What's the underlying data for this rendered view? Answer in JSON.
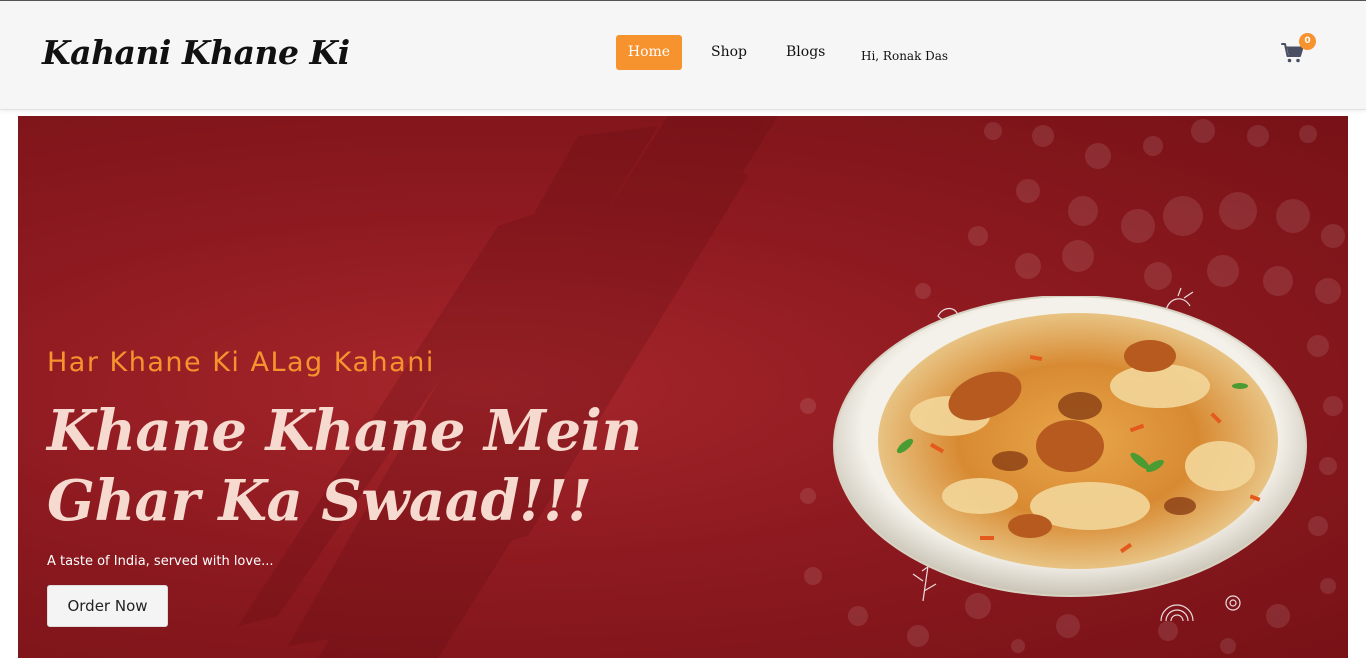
{
  "navbar": {
    "brand": "Kahani Khane Ki",
    "links": [
      {
        "label": "Home",
        "active": true
      },
      {
        "label": "Shop",
        "active": false
      },
      {
        "label": "Blogs",
        "active": false
      }
    ],
    "user_greeting": "Hi, Ronak Das",
    "cart_count": "0"
  },
  "hero": {
    "tagline": "Har Khane Ki ALag Kahani",
    "headline": "Khane Khane Mein Ghar Ka Swaad!!!",
    "subtitle": "A taste of India, served with love...",
    "cta_label": "Order Now"
  },
  "icons": {
    "cart": "cart-icon",
    "hero_image": "biryani-plate-image"
  },
  "colors": {
    "accent": "#f7932e",
    "hero_bg": "#8e1a20",
    "headline": "#f6d9cf",
    "navbar_bg": "#f6f6f6"
  }
}
